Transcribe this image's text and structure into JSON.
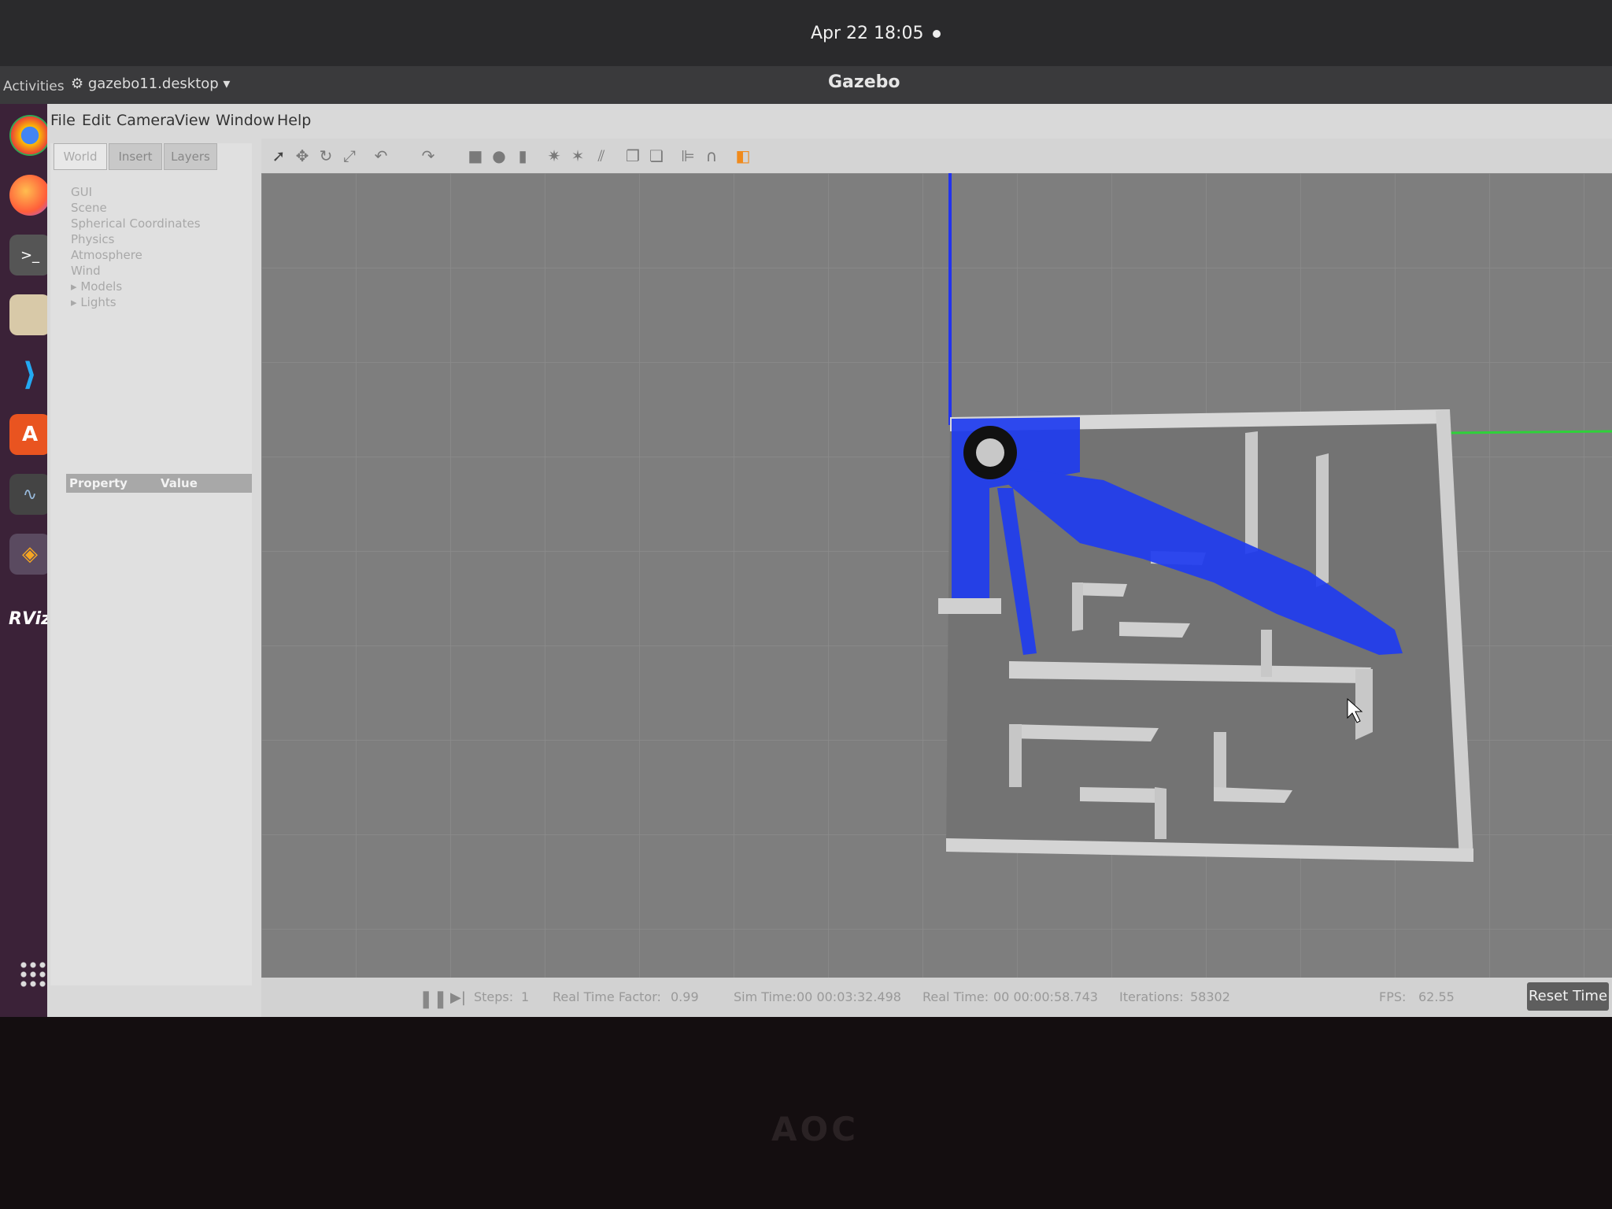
{
  "system": {
    "clock": "Apr 22  18:05",
    "activities": "Activities",
    "desktop_file": "gazebo11.desktop"
  },
  "window": {
    "title": "Gazebo"
  },
  "menu": [
    "File",
    "Edit",
    "Camera",
    "View",
    "Window",
    "Help"
  ],
  "left_panel": {
    "tabs": [
      "World",
      "Insert",
      "Layers"
    ],
    "tree": [
      "GUI",
      "Scene",
      "Spherical Coordinates",
      "Physics",
      "Atmosphere",
      "Wind",
      "Models",
      "Lights"
    ],
    "property_header": "Property",
    "value_header": "Value"
  },
  "toolbar_icons": [
    "select-icon",
    "translate-icon",
    "rotate-icon",
    "scale-icon",
    "undo-icon",
    "redo-icon",
    "box-icon",
    "sphere-icon",
    "cylinder-icon",
    "point-light-icon",
    "spot-light-icon",
    "directional-light-icon",
    "copy-icon",
    "paste-icon",
    "align-icon",
    "snap-icon",
    "screenshot-icon"
  ],
  "dock_icons": [
    "chrome-icon",
    "firefox-icon",
    "terminal-icon",
    "files-icon",
    "vscode-icon",
    "software-icon",
    "monitor-icon",
    "gazebo-icon",
    "rviz-icon",
    "apps-grid-icon"
  ],
  "dock_labels": {
    "rviz": "RViz"
  },
  "status": {
    "steps_label": "Steps:",
    "steps_value": "1",
    "rtf_label": "Real Time Factor:",
    "rtf_value": "0.99",
    "sim_time_label": "Sim Time:",
    "sim_time_value": "00 00:03:32.498",
    "real_time_label": "Real Time:",
    "real_time_value": "00 00:00:58.743",
    "iterations_label": "Iterations:",
    "iterations_value": "58302",
    "fps_label": "FPS:",
    "fps_value": "62.55",
    "reset_button": "Reset Time"
  },
  "monitor": {
    "brand": "AOC"
  },
  "colors": {
    "laser": "#1f3cf0",
    "axis_x": "#2fd13a",
    "axis_z": "#2233ee",
    "wall": "#cfcfcf",
    "floor": "#7e7e7e"
  }
}
